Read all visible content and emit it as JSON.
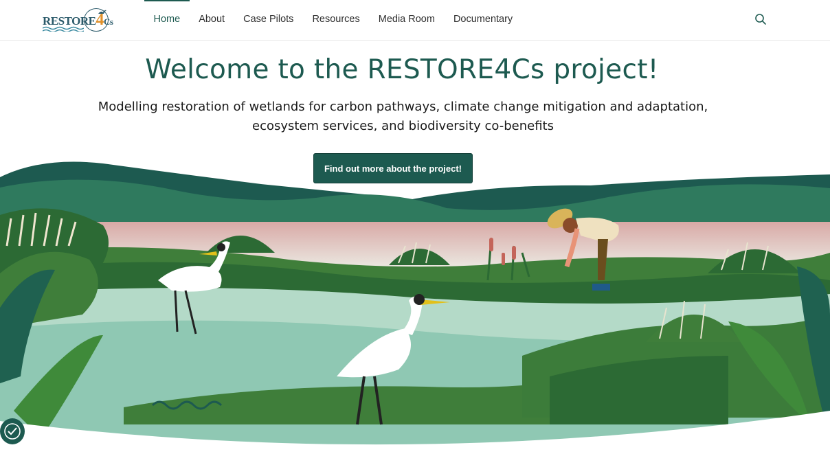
{
  "logo": {
    "text": "RESTORE",
    "four": "4",
    "cs": "Cs"
  },
  "nav": {
    "items": [
      {
        "label": "Home",
        "active": true
      },
      {
        "label": "About"
      },
      {
        "label": "Case Pilots"
      },
      {
        "label": "Resources"
      },
      {
        "label": "Media Room"
      },
      {
        "label": "Documentary"
      }
    ]
  },
  "hero": {
    "title": "Welcome to the RESTORE4Cs project!",
    "subtitle": "Modelling restoration of wetlands for carbon pathways, climate change mitigation and adaptation, ecosystem services, and biodiversity co-benefits",
    "cta_label": "Find out more about the project!"
  },
  "colors": {
    "brand": "#1d5a50",
    "accent": "#e0912b"
  },
  "icons": {
    "search": "search-icon",
    "cookie": "cookie-settings-icon"
  }
}
